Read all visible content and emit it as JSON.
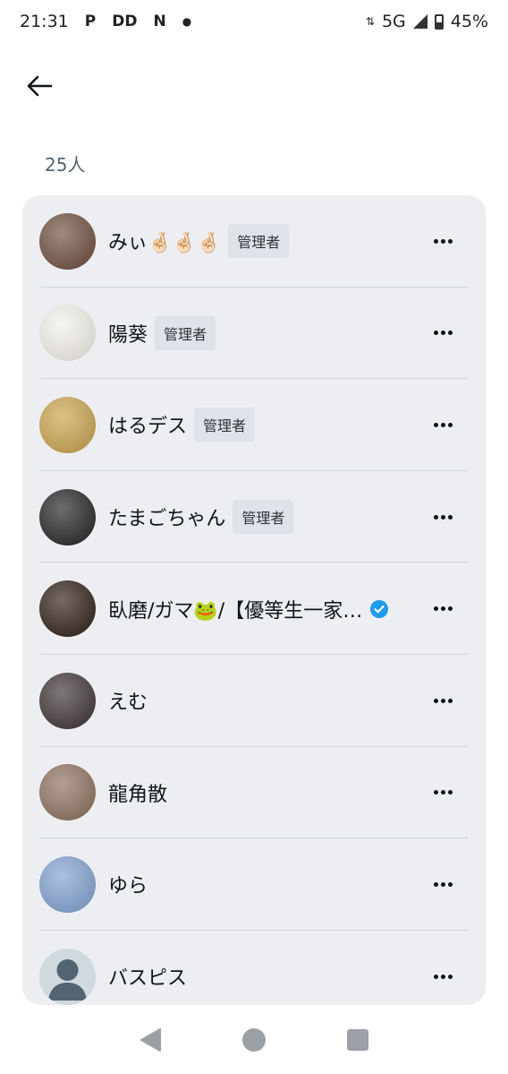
{
  "status_bar": {
    "time": "21:31",
    "notif_icons": [
      "P",
      "DD",
      "N"
    ],
    "network": "5G",
    "battery": "45%",
    "battery_level": 0.45
  },
  "header": {
    "member_count": "25人"
  },
  "members": [
    {
      "name": "みぃ🤞🏻🤞🏻🤞🏻",
      "badge": "管理者",
      "verified": false,
      "avatar_color": "#6b4a3a"
    },
    {
      "name": "陽葵",
      "badge": "管理者",
      "verified": false,
      "avatar_color": "#f3f0ea"
    },
    {
      "name": "はるデス",
      "badge": "管理者",
      "verified": false,
      "avatar_color": "#c9a14a"
    },
    {
      "name": "たまごちゃん",
      "badge": "管理者",
      "verified": false,
      "avatar_color": "#1f1f1f"
    },
    {
      "name": "臥磨/ガマ🐸/【優等生一家…",
      "badge": "",
      "verified": true,
      "avatar_color": "#2b1b12"
    },
    {
      "name": "えむ",
      "badge": "",
      "verified": false,
      "avatar_color": "#3a3030"
    },
    {
      "name": "龍角散",
      "badge": "",
      "verified": false,
      "avatar_color": "#8a6d5a"
    },
    {
      "name": "ゆら",
      "badge": "",
      "verified": false,
      "avatar_color": "#7f9fd0"
    },
    {
      "name": "バスピス",
      "badge": "",
      "verified": false,
      "avatar_color": "#cfd9de"
    }
  ],
  "colors": {
    "panel_bg": "#eceef1",
    "badge_bg": "#dde3e8",
    "verified_blue": "#1d9bf0"
  }
}
